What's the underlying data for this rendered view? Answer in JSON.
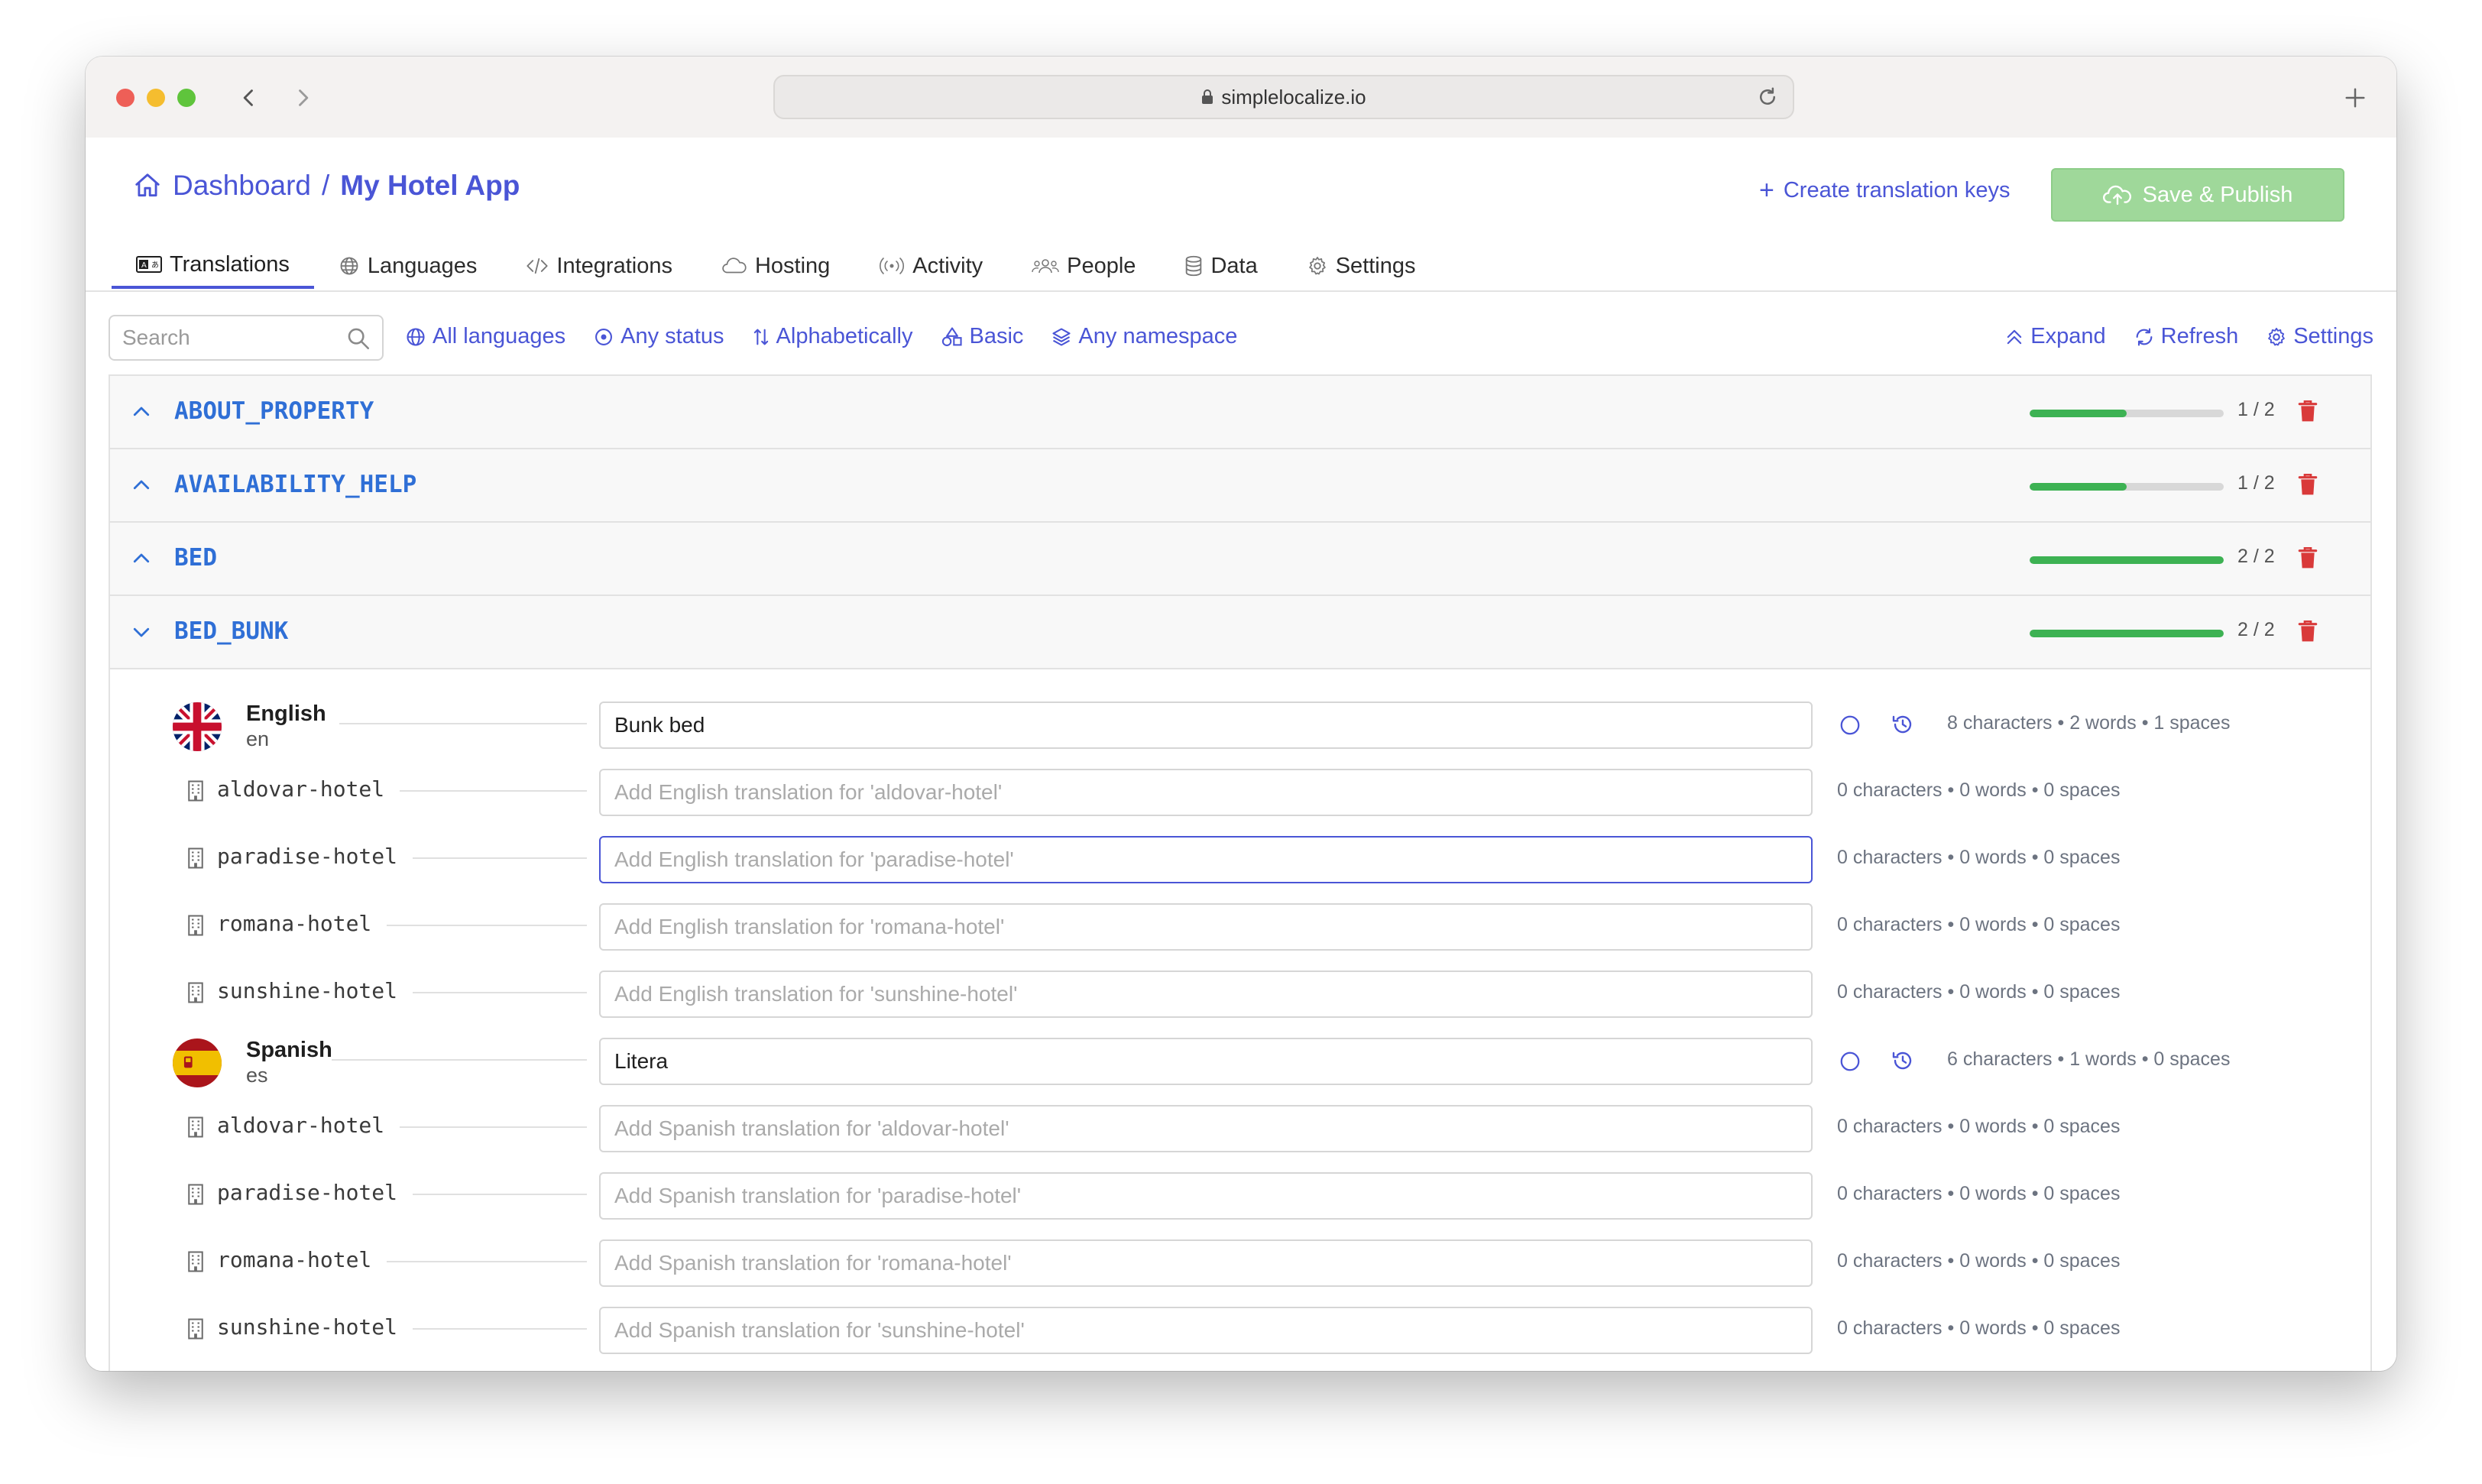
{
  "browser": {
    "url": "simplelocalize.io"
  },
  "header": {
    "breadcrumb_root": "Dashboard",
    "breadcrumb_sep": "/",
    "project_name": "My Hotel App",
    "create_keys_label": "Create translation keys",
    "save_label": "Save & Publish",
    "save_color": "#9fd89a",
    "accent_color": "#4a55d6"
  },
  "tabs": [
    {
      "label": "Translations",
      "icon": "translations-icon",
      "active": true
    },
    {
      "label": "Languages",
      "icon": "globe-icon"
    },
    {
      "label": "Integrations",
      "icon": "code-icon"
    },
    {
      "label": "Hosting",
      "icon": "cloud-icon"
    },
    {
      "label": "Activity",
      "icon": "broadcast-icon"
    },
    {
      "label": "People",
      "icon": "people-icon"
    },
    {
      "label": "Data",
      "icon": "database-icon"
    },
    {
      "label": "Settings",
      "icon": "gear-icon"
    }
  ],
  "filters": {
    "search_placeholder": "Search",
    "languages": "All languages",
    "status": "Any status",
    "sort": "Alphabetically",
    "view": "Basic",
    "namespace": "Any namespace",
    "expand": "Expand",
    "refresh": "Refresh",
    "settings": "Settings"
  },
  "keys": [
    {
      "name": "ABOUT_PROPERTY",
      "count": "1 / 2",
      "progress": 0.5,
      "expanded": false
    },
    {
      "name": "AVAILABILITY_HELP",
      "count": "1 / 2",
      "progress": 0.5,
      "expanded": false
    },
    {
      "name": "BED",
      "count": "2 / 2",
      "progress": 1.0,
      "expanded": false
    },
    {
      "name": "BED_BUNK",
      "count": "2 / 2",
      "progress": 1.0,
      "expanded": true
    }
  ],
  "bed_bunk": {
    "languages": [
      {
        "name": "English",
        "code": "en",
        "flag": "uk-flag-icon",
        "value": "Bunk bed",
        "stats": "8 characters • 2 words • 1 spaces",
        "customers": [
          {
            "name": "aldovar-hotel",
            "placeholder": "Add English translation for 'aldovar-hotel'",
            "stats": "0 characters • 0 words • 0 spaces"
          },
          {
            "name": "paradise-hotel",
            "placeholder": "Add English translation for 'paradise-hotel'",
            "stats": "0 characters • 0 words • 0 spaces",
            "focused": true
          },
          {
            "name": "romana-hotel",
            "placeholder": "Add English translation for 'romana-hotel'",
            "stats": "0 characters • 0 words • 0 spaces"
          },
          {
            "name": "sunshine-hotel",
            "placeholder": "Add English translation for 'sunshine-hotel'",
            "stats": "0 characters • 0 words • 0 spaces"
          }
        ]
      },
      {
        "name": "Spanish",
        "code": "es",
        "flag": "spain-flag-icon",
        "value": "Litera",
        "stats": "6 characters • 1 words • 0 spaces",
        "customers": [
          {
            "name": "aldovar-hotel",
            "placeholder": "Add Spanish translation for 'aldovar-hotel'",
            "stats": "0 characters • 0 words • 0 spaces"
          },
          {
            "name": "paradise-hotel",
            "placeholder": "Add Spanish translation for 'paradise-hotel'",
            "stats": "0 characters • 0 words • 0 spaces"
          },
          {
            "name": "romana-hotel",
            "placeholder": "Add Spanish translation for 'romana-hotel'",
            "stats": "0 characters • 0 words • 0 spaces"
          },
          {
            "name": "sunshine-hotel",
            "placeholder": "Add Spanish translation for 'sunshine-hotel'",
            "stats": "0 characters • 0 words • 0 spaces"
          }
        ]
      }
    ]
  }
}
